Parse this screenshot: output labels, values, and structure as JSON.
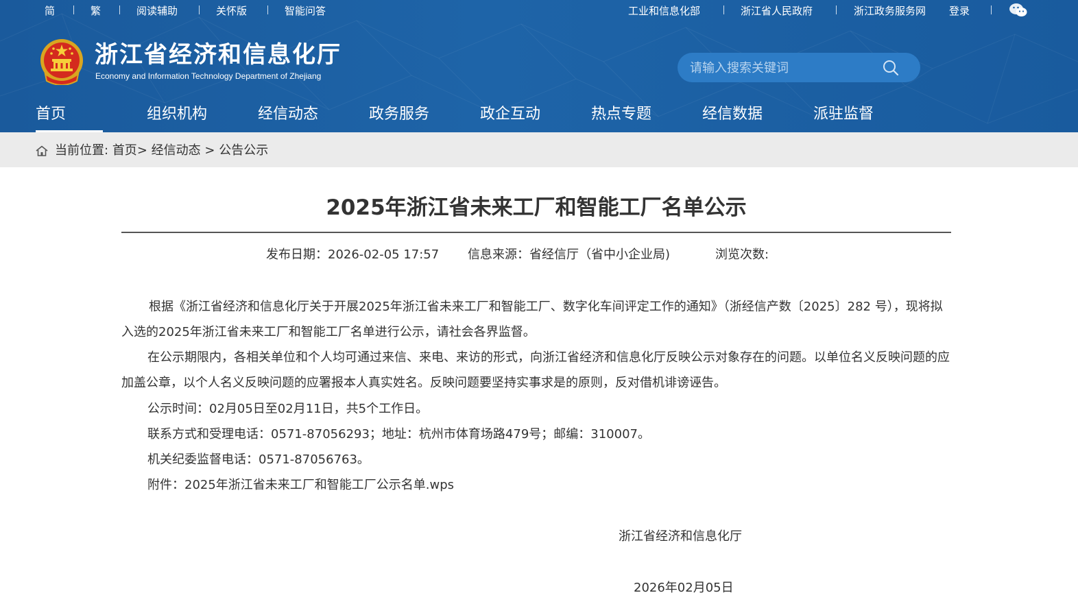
{
  "topbar": {
    "left": [
      "简",
      "繁",
      "阅读辅助",
      "关怀版",
      "智能问答"
    ],
    "right": [
      "工业和信息化部",
      "浙江省人民政府",
      "浙江政务服务网",
      "登录"
    ]
  },
  "site": {
    "title": "浙江省经济和信息化厅",
    "subtitle": "Economy and Information Technology Department of Zhejiang"
  },
  "search": {
    "placeholder": "请输入搜索关键词"
  },
  "nav": [
    "首页",
    "组织机构",
    "经信动态",
    "政务服务",
    "政企互动",
    "热点专题",
    "经信数据",
    "派驻监督"
  ],
  "breadcrumb": {
    "prefix": "当前位置:",
    "items": [
      "首页",
      "经信动态",
      "公告公示"
    ],
    "separator": ">"
  },
  "article": {
    "title": "2025年浙江省未来工厂和智能工厂名单公示",
    "meta": {
      "date_label": "发布日期：",
      "date": "2026-02-05 17:57",
      "source_label": "信息来源：",
      "source": "省经信厅（省中小企业局)",
      "views_label": "浏览次数:"
    },
    "paragraphs": [
      "根据《浙江省经济和信息化厅关于开展2025年浙江省未来工厂和智能工厂、数字化车间评定工作的通知》（浙经信产数〔2025〕282 号），现将拟入选的2025年浙江省未来工厂和智能工厂名单进行公示，请社会各界监督。",
      "在公示期限内，各相关单位和个人均可通过来信、来电、来访的形式，向浙江省经济和信息化厅反映公示对象存在的问题。以单位名义反映问题的应加盖公章，以个人名义反映问题的应署报本人真实姓名。反映问题要坚持实事求是的原则，反对借机诽谤诬告。"
    ],
    "lines": [
      "公示时间：02月05日至02月11日，共5个工作日。",
      "联系方式和受理电话：0571-87056293；地址：杭州市体育场路479号；邮编：310007。",
      "机关纪委监督电话：0571-87056763。"
    ],
    "attachment_label": "附件：",
    "attachment_name": "2025年浙江省未来工厂和智能工厂公示名单.wps",
    "signature": "浙江省经济和信息化厅",
    "sign_date": "2026年02月05日"
  }
}
